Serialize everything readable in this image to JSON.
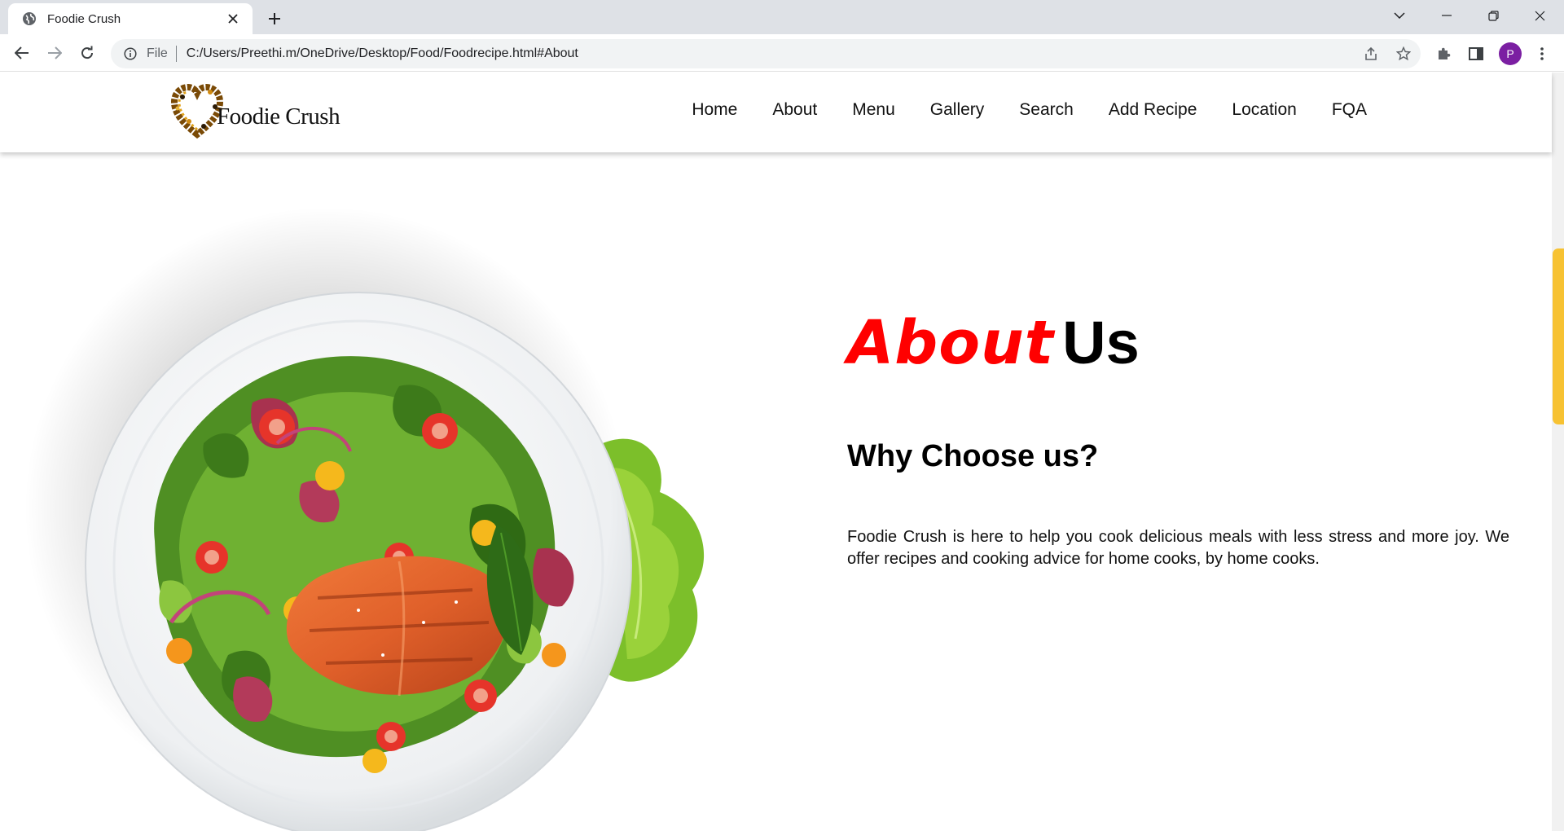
{
  "browser": {
    "tab_title": "Foodie Crush",
    "scheme_label": "File",
    "url": "C:/Users/Preethi.m/OneDrive/Desktop/Food/Foodrecipe.html#About",
    "profile_initial": "P"
  },
  "header": {
    "logo_text": "Foodie Crush",
    "nav": [
      "Home",
      "About",
      "Menu",
      "Gallery",
      "Search",
      "Add Recipe",
      "Location",
      "FQA"
    ]
  },
  "about": {
    "title_accent": "About",
    "title_rest": "Us",
    "subtitle": "Why Choose us?",
    "description": "Foodie Crush is here to help you cook delicious meals with less stress and more joy. We offer recipes and cooking advice for home cooks, by home cooks."
  },
  "colors": {
    "accent_red": "#ff0000",
    "scroll_thumb": "#f7c232",
    "profile_purple": "#7b1fa2"
  },
  "icons": [
    "globe-icon",
    "close-icon",
    "plus-icon",
    "chevron-down-icon",
    "minimize-icon",
    "restore-icon",
    "back-arrow-icon",
    "forward-arrow-icon",
    "reload-icon",
    "info-icon",
    "share-icon",
    "star-icon",
    "puzzle-icon",
    "side-panel-icon",
    "kebab-menu-icon"
  ]
}
